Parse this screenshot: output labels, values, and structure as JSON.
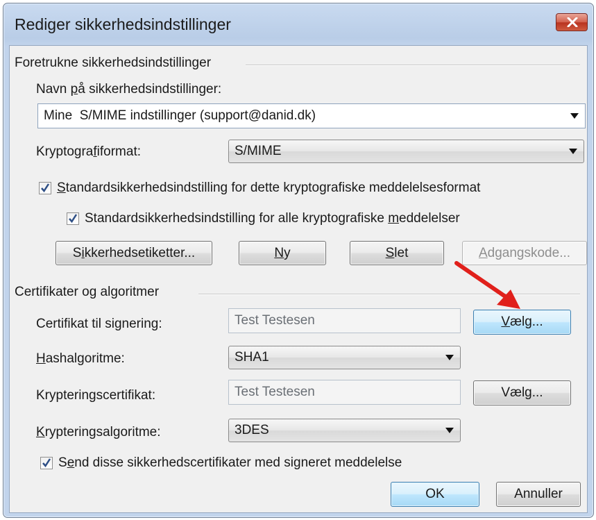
{
  "window": {
    "title": "Rediger sikkerhedsindstillinger",
    "close_icon": "close-icon",
    "close_color": "#c8452f"
  },
  "preferred": {
    "group_label": "Foretrukne sikkerhedsindstillinger",
    "name_label": "Navn på sikkerhedsindstillinger:",
    "name_value": "Mine  S/MIME indstillinger (support@danid.dk)",
    "crypto_label": "Kryptografiformat:",
    "crypto_value": "S/MIME",
    "default_format_label": "Standardsikkerhedsindstilling for dette kryptografiske meddelelsesformat",
    "default_format_checked": true,
    "default_all_label": "Standardsikkerhedsindstilling for alle kryptografiske meddelelser",
    "default_all_checked": true
  },
  "buttons": {
    "labels": "Sikkerhedsetiketter...",
    "new": "Ny",
    "delete": "Slet",
    "password": "Adgangskode...",
    "choose": "Vælg...",
    "ok": "OK",
    "cancel": "Annuller"
  },
  "certs": {
    "group_label": "Certifikater og algoritmer",
    "signing_label": "Certifikat til signering:",
    "signing_value": "Test Testesen",
    "hash_label": "Hashalgoritme:",
    "hash_value": "SHA1",
    "enc_cert_label": "Krypteringscertifikat:",
    "enc_cert_value": "Test Testesen",
    "enc_alg_label": "Krypteringsalgoritme:",
    "enc_alg_value": "3DES",
    "send_label": "Send disse sikkerhedscertifikater med signeret meddelelse",
    "send_checked": true
  },
  "annotation": {
    "arrow_color": "#e0201b",
    "arrow_icon": "red-arrow-icon"
  }
}
